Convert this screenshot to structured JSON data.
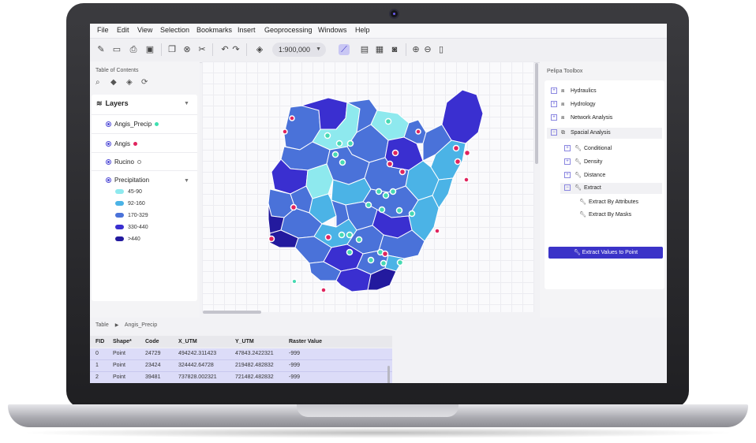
{
  "menu": [
    "File",
    "Edit",
    "View",
    "Selection",
    "Bookmarks",
    "Insert",
    "Geoprocessing",
    "Windows",
    "Help"
  ],
  "toolbar": {
    "scale": "1:900,000",
    "icons": [
      "edit-icon",
      "folder-open-icon",
      "print-icon",
      "save-icon",
      "copy-icon",
      "delete-icon",
      "cut-icon",
      "undo-icon",
      "redo-icon",
      "navigate-icon",
      "select-features-icon",
      "layout-icon",
      "table-icon",
      "camera-icon",
      "zoom-in-icon",
      "zoom-out-icon",
      "page-icon"
    ]
  },
  "toc": {
    "title": "Table of Contents",
    "layers_label": "Layers",
    "layers": [
      {
        "name": "Angis_Precip",
        "color": "#3ee0b0"
      },
      {
        "name": "Angis",
        "color": "#e0245e"
      },
      {
        "name": "Rucino",
        "color": "#ffffff"
      },
      {
        "name": "Precipitation",
        "color": ""
      }
    ],
    "legend": [
      {
        "label": "45-90",
        "color": "#8ee9ee"
      },
      {
        "label": "92-160",
        "color": "#4bb3e6"
      },
      {
        "label": "170-329",
        "color": "#4a72d9"
      },
      {
        "label": "330-440",
        "color": "#3a2fd0"
      },
      {
        "label": ">440",
        "color": "#231a9e"
      }
    ]
  },
  "toolbox": {
    "title": "Pelipa Toolbox",
    "items": [
      {
        "label": "Hydraulics",
        "level": 0,
        "expander": "+"
      },
      {
        "label": "Hydrology",
        "level": 0,
        "expander": "+"
      },
      {
        "label": "Network Analysis",
        "level": 0,
        "expander": "+"
      },
      {
        "label": "Spacial Analysis",
        "level": 0,
        "expander": "−"
      },
      {
        "label": "Conditional",
        "level": 1,
        "expander": "+"
      },
      {
        "label": "Density",
        "level": 1,
        "expander": "+"
      },
      {
        "label": "Distance",
        "level": 1,
        "expander": "+"
      },
      {
        "label": "Extract",
        "level": 1,
        "expander": "−"
      },
      {
        "label": "Extract By Attributes",
        "level": 2,
        "expander": ""
      },
      {
        "label": "Extract By Masks",
        "level": 2,
        "expander": ""
      }
    ],
    "selected_tool": "Extract Values to Point"
  },
  "table": {
    "breadcrumb_root": "Table",
    "breadcrumb_layer": "Angis_Precip",
    "columns": [
      "FID",
      "Shape*",
      "Code",
      "X_UTM",
      "Y_UTM",
      "Raster Value"
    ],
    "rows": [
      [
        "0",
        "Point",
        "24729",
        "494242.311423",
        "47843.2422321",
        "-999"
      ],
      [
        "1",
        "Point",
        "23424",
        "324442.64728",
        "219482.482832",
        "-999"
      ],
      [
        "2",
        "Point",
        "39481",
        "737828.002321",
        "721482.482832",
        "-999"
      ]
    ]
  },
  "colors": {
    "accent": "#3b33c8",
    "selection_row": "#dcdcf8"
  }
}
